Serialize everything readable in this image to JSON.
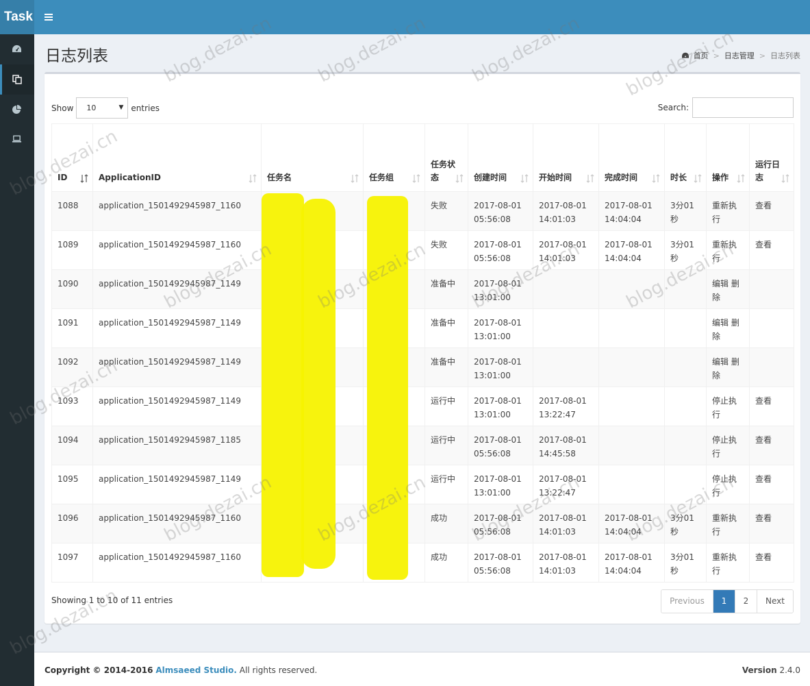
{
  "header": {
    "logo": "Task"
  },
  "sidebar": {
    "items": [
      {
        "icon": "dashboard-icon"
      },
      {
        "icon": "copy-icon",
        "active": true
      },
      {
        "icon": "pie-chart-icon"
      },
      {
        "icon": "laptop-icon"
      }
    ]
  },
  "page": {
    "title": "日志列表",
    "breadcrumb": {
      "home": "首页",
      "section": "日志管理",
      "current": "日志列表"
    }
  },
  "controls": {
    "show_label": "Show",
    "page_size": "10",
    "entries_label": "entries",
    "search_label": "Search:",
    "search_placeholder": ""
  },
  "table": {
    "headers": [
      "ID",
      "ApplicationID",
      "任务名",
      "任务组",
      "任务状态",
      "创建时间",
      "开始时间",
      "完成时间",
      "时长",
      "操作",
      "运行日志"
    ],
    "rows": [
      {
        "id": "1088",
        "app": "application_1501492945987_1160",
        "name": "",
        "group": "",
        "status": "失败",
        "created": "2017-08-01 05:56:08",
        "started": "2017-08-01 14:01:03",
        "finished": "2017-08-01 14:04:04",
        "duration": "3分01秒",
        "action": "重新执行",
        "log": "查看"
      },
      {
        "id": "1089",
        "app": "application_1501492945987_1160",
        "name": "",
        "group": "",
        "status": "失败",
        "created": "2017-08-01 05:56:08",
        "started": "2017-08-01 14:01:03",
        "finished": "2017-08-01 14:04:04",
        "duration": "3分01秒",
        "action": "重新执行",
        "log": "查看"
      },
      {
        "id": "1090",
        "app": "application_1501492945987_1149",
        "name": "",
        "group": "",
        "status": "准备中",
        "created": "2017-08-01 13:01:00",
        "started": "",
        "finished": "",
        "duration": "",
        "action": "编辑 删除",
        "log": ""
      },
      {
        "id": "1091",
        "app": "application_1501492945987_1149",
        "name": "",
        "group": "",
        "status": "准备中",
        "created": "2017-08-01 13:01:00",
        "started": "",
        "finished": "",
        "duration": "",
        "action": "编辑 删除",
        "log": ""
      },
      {
        "id": "1092",
        "app": "application_1501492945987_1149",
        "name": "",
        "group": "",
        "status": "准备中",
        "created": "2017-08-01 13:01:00",
        "started": "",
        "finished": "",
        "duration": "",
        "action": "编辑 删除",
        "log": ""
      },
      {
        "id": "1093",
        "app": "application_1501492945987_1149",
        "name": "",
        "group": "",
        "status": "运行中",
        "created": "2017-08-01 13:01:00",
        "started": "2017-08-01 13:22:47",
        "finished": "",
        "duration": "",
        "action": "停止执行",
        "log": "查看"
      },
      {
        "id": "1094",
        "app": "application_1501492945987_1185",
        "name": "",
        "group": "",
        "status": "运行中",
        "created": "2017-08-01 05:56:08",
        "started": "2017-08-01 14:45:58",
        "finished": "",
        "duration": "",
        "action": "停止执行",
        "log": "查看"
      },
      {
        "id": "1095",
        "app": "application_1501492945987_1149",
        "name": "",
        "group": "",
        "status": "运行中",
        "created": "2017-08-01 13:01:00",
        "started": "2017-08-01 13:22:47",
        "finished": "",
        "duration": "",
        "action": "停止执行",
        "log": "查看"
      },
      {
        "id": "1096",
        "app": "application_1501492945987_1160",
        "name": "",
        "group": "",
        "status": "成功",
        "created": "2017-08-01 05:56:08",
        "started": "2017-08-01 14:01:03",
        "finished": "2017-08-01 14:04:04",
        "duration": "3分01秒",
        "action": "重新执行",
        "log": "查看"
      },
      {
        "id": "1097",
        "app": "application_1501492945987_1160",
        "name": "",
        "group": "",
        "status": "成功",
        "created": "2017-08-01 05:56:08",
        "started": "2017-08-01 14:01:03",
        "finished": "2017-08-01 14:04:04",
        "duration": "3分01秒",
        "action": "重新执行",
        "log": "查看"
      }
    ]
  },
  "footer_info": "Showing 1 to 10 of 11 entries",
  "pagination": {
    "previous": "Previous",
    "pages": [
      "1",
      "2"
    ],
    "active": "1",
    "next": "Next"
  },
  "page_footer": {
    "copyright_prefix": "Copyright © 2014-2016",
    "brand": "Almsaeed Studio.",
    "copyright_suffix": "All rights reserved.",
    "version_label": "Version",
    "version": "2.4.0"
  },
  "watermark": "blog.dezai.cn",
  "colors": {
    "header": "#3c8dbc",
    "logo": "#367fa9",
    "sidebar": "#222d32",
    "primary": "#337ab7",
    "redaction": "#f7f200"
  }
}
